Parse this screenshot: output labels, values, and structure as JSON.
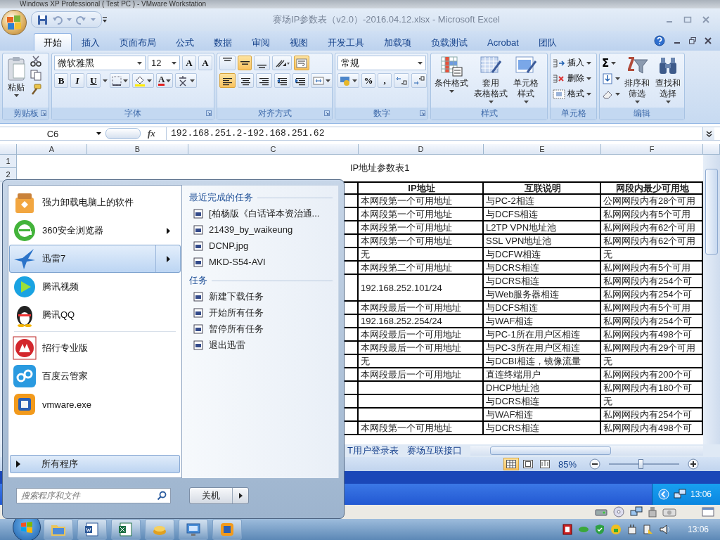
{
  "vmware_title": "Windows XP Professional ( Test PC ) - VMware Workstation",
  "excel": {
    "title": "赛场IP参数表（v2.0）-2016.04.12.xlsx - Microsoft Excel",
    "tabs": [
      {
        "label": "开始",
        "selected": true
      },
      {
        "label": "插入",
        "selected": false
      },
      {
        "label": "页面布局",
        "selected": false
      },
      {
        "label": "公式",
        "selected": false
      },
      {
        "label": "数据",
        "selected": false
      },
      {
        "label": "审阅",
        "selected": false
      },
      {
        "label": "视图",
        "selected": false
      },
      {
        "label": "开发工具",
        "selected": false
      },
      {
        "label": "加载项",
        "selected": false
      },
      {
        "label": "负载测试",
        "selected": false
      },
      {
        "label": "Acrobat",
        "selected": false
      },
      {
        "label": "团队",
        "selected": false
      }
    ],
    "ribbon": {
      "clipboard": {
        "paste": "粘贴",
        "label": "剪贴板"
      },
      "font": {
        "name": "微软雅黑",
        "size": "12",
        "grow": "A",
        "shrink": "A",
        "bold": "B",
        "italic": "I",
        "underline": "U",
        "color_letter": "A",
        "label": "字体"
      },
      "alignment": {
        "top_row": [
          {
            "kind": "align-top",
            "selected": false
          },
          {
            "kind": "align-middle",
            "selected": true
          },
          {
            "kind": "align-bottom",
            "selected": false
          },
          {
            "kind": "orientation",
            "selected": false
          }
        ],
        "wrap": {
          "selected": true
        },
        "bottom_row": [
          {
            "kind": "align-left",
            "selected": true
          },
          {
            "kind": "align-center",
            "selected": false
          },
          {
            "kind": "align-right",
            "selected": false
          },
          {
            "kind": "indent-decrease",
            "selected": false
          },
          {
            "kind": "indent-increase",
            "selected": false
          }
        ],
        "label": "对齐方式"
      },
      "number": {
        "format": "常规",
        "percent": "%",
        "comma": ",",
        "label": "数字"
      },
      "styles": {
        "buttons": [
          {
            "kind": "conditional",
            "lines": [
              "条件格式"
            ]
          },
          {
            "kind": "table",
            "lines": [
              "套用",
              "表格格式"
            ]
          },
          {
            "kind": "cell",
            "lines": [
              "单元格",
              "样式"
            ]
          }
        ],
        "label": "样式"
      },
      "cells": {
        "buttons": [
          {
            "kind": "insert",
            "label": "插入"
          },
          {
            "kind": "delete",
            "label": "删除"
          },
          {
            "kind": "format",
            "label": "格式"
          }
        ],
        "label": "单元格"
      },
      "editing": {
        "sum": "Σ",
        "buttons": [
          {
            "kind": "sort",
            "lines": [
              "排序和",
              "筛选"
            ]
          },
          {
            "kind": "find",
            "lines": [
              "查找和",
              "选择"
            ]
          }
        ],
        "label": "编辑"
      }
    },
    "formula_bar": {
      "cell": "C6",
      "fx": "fx",
      "value": "192.168.251.2-192.168.251.62"
    },
    "column_headers": [
      "A",
      "B",
      "C",
      "D",
      "E",
      "F"
    ],
    "row_headers": [
      "1",
      "2"
    ],
    "sheet": {
      "title": "IP地址参数表1",
      "header": [
        "IP地址",
        "互联说明",
        "网段内最少可用地"
      ],
      "groups": [
        {
          "ip": "本网段第一个可用地址",
          "links": [
            {
              "desc": "与PC-2相连",
              "avail": "公网网段内有28个可用"
            }
          ]
        },
        {
          "ip": "本网段第一个可用地址",
          "links": [
            {
              "desc": "与DCFS相连",
              "avail": "私网网段内有5个可用"
            }
          ]
        },
        {
          "ip": "本网段第一个可用地址",
          "links": [
            {
              "desc": "L2TP VPN地址池",
              "avail": "私网网段内有62个可用"
            }
          ]
        },
        {
          "ip": "本网段第一个可用地址",
          "links": [
            {
              "desc": "SSL VPN地址池",
              "avail": "私网网段内有62个可用"
            }
          ]
        },
        {
          "ip": "无",
          "links": [
            {
              "desc": "与DCFW相连",
              "avail": "无"
            }
          ]
        },
        {
          "ip": "本网段第二个可用地址",
          "links": [
            {
              "desc": "与DCRS相连",
              "avail": "私网网段内有5个可用"
            }
          ]
        },
        {
          "ip": "192.168.252.101/24",
          "links": [
            {
              "desc": "与DCRS相连",
              "avail": "私网网段内有254个可"
            },
            {
              "desc": "与Web服务器相连",
              "avail": "私网网段内有254个可"
            }
          ]
        },
        {
          "ip": "本网段最后一个可用地址",
          "links": [
            {
              "desc": "与DCFS相连",
              "avail": "私网网段内有5个可用"
            }
          ]
        },
        {
          "ip": "192.168.252.254/24",
          "links": [
            {
              "desc": "与WAF相连",
              "avail": "私网网段内有254个可"
            }
          ]
        },
        {
          "ip": "本网段最后一个可用地址",
          "links": [
            {
              "desc": "与PC-1所在用户区相连",
              "avail": "私网网段内有498个可"
            }
          ]
        },
        {
          "ip": "本网段最后一个可用地址",
          "links": [
            {
              "desc": "与PC-3所在用户区相连",
              "avail": "私网网段内有29个可用"
            }
          ]
        },
        {
          "ip": "无",
          "links": [
            {
              "desc": "与DCBI相连，镜像流量",
              "avail": "无"
            }
          ]
        },
        {
          "ip": "本网段最后一个可用地址",
          "links": [
            {
              "desc": "直连终端用户",
              "avail": "私网网段内有200个可"
            }
          ]
        },
        {
          "links": [
            {
              "desc": "DHCP地址池",
              "avail": "私网网段内有180个可"
            }
          ]
        },
        {
          "links": [
            {
              "desc": "与DCRS相连",
              "avail": "无"
            }
          ]
        },
        {
          "links": [
            {
              "desc": "与WAF相连",
              "avail": "私网网段内有254个可"
            }
          ]
        },
        {
          "ip": "本网段第一个可用地址",
          "links": [
            {
              "desc": "与DCRS相连",
              "avail": "私网网段内有498个可"
            }
          ]
        }
      ]
    },
    "sheet_tabs": [
      "T用户登录表",
      "赛场互联接口"
    ],
    "status_bar": {
      "views": [
        {
          "kind": "normal",
          "selected": true
        },
        {
          "kind": "page-layout",
          "selected": false
        },
        {
          "kind": "page-break",
          "selected": false
        }
      ],
      "zoom": "85%",
      "zoom_slider": {
        "level": 0.45
      }
    }
  },
  "xp_taskbar": {
    "clock": "13:06"
  },
  "start_menu": {
    "pinned": [
      {
        "label": "强力卸载电脑上的软件",
        "has_submenu": false,
        "selected": false
      },
      {
        "label": "360安全浏览器",
        "has_submenu": true,
        "selected": false
      },
      {
        "label": "迅雷7",
        "has_submenu": true,
        "selected": true
      },
      {
        "label": "腾讯视频",
        "has_submenu": false,
        "selected": false
      },
      {
        "label": "腾讯QQ",
        "has_submenu": false,
        "selected": false
      }
    ],
    "recent": [
      {
        "label": "招行专业版",
        "has_submenu": false,
        "selected": false
      },
      {
        "label": "百度云管家",
        "has_submenu": false,
        "selected": false
      },
      {
        "label": "vmware.exe",
        "has_submenu": false,
        "selected": false
      }
    ],
    "jump_list": [
      {
        "title": "最近完成的任务",
        "items": [
          "[柏杨版《白话译本资治通...",
          "21439_by_waikeung",
          "DCNP.jpg",
          "MKD-S54-AVI"
        ]
      },
      {
        "title": "任务",
        "items": [
          "新建下载任务",
          "开始所有任务",
          "暂停所有任务",
          "退出迅雷"
        ]
      }
    ],
    "all_programs": "所有程序",
    "search": {
      "placeholder": "搜索程序和文件"
    },
    "shutdown": "关机"
  },
  "taskbar": {
    "clock": "13:06"
  }
}
